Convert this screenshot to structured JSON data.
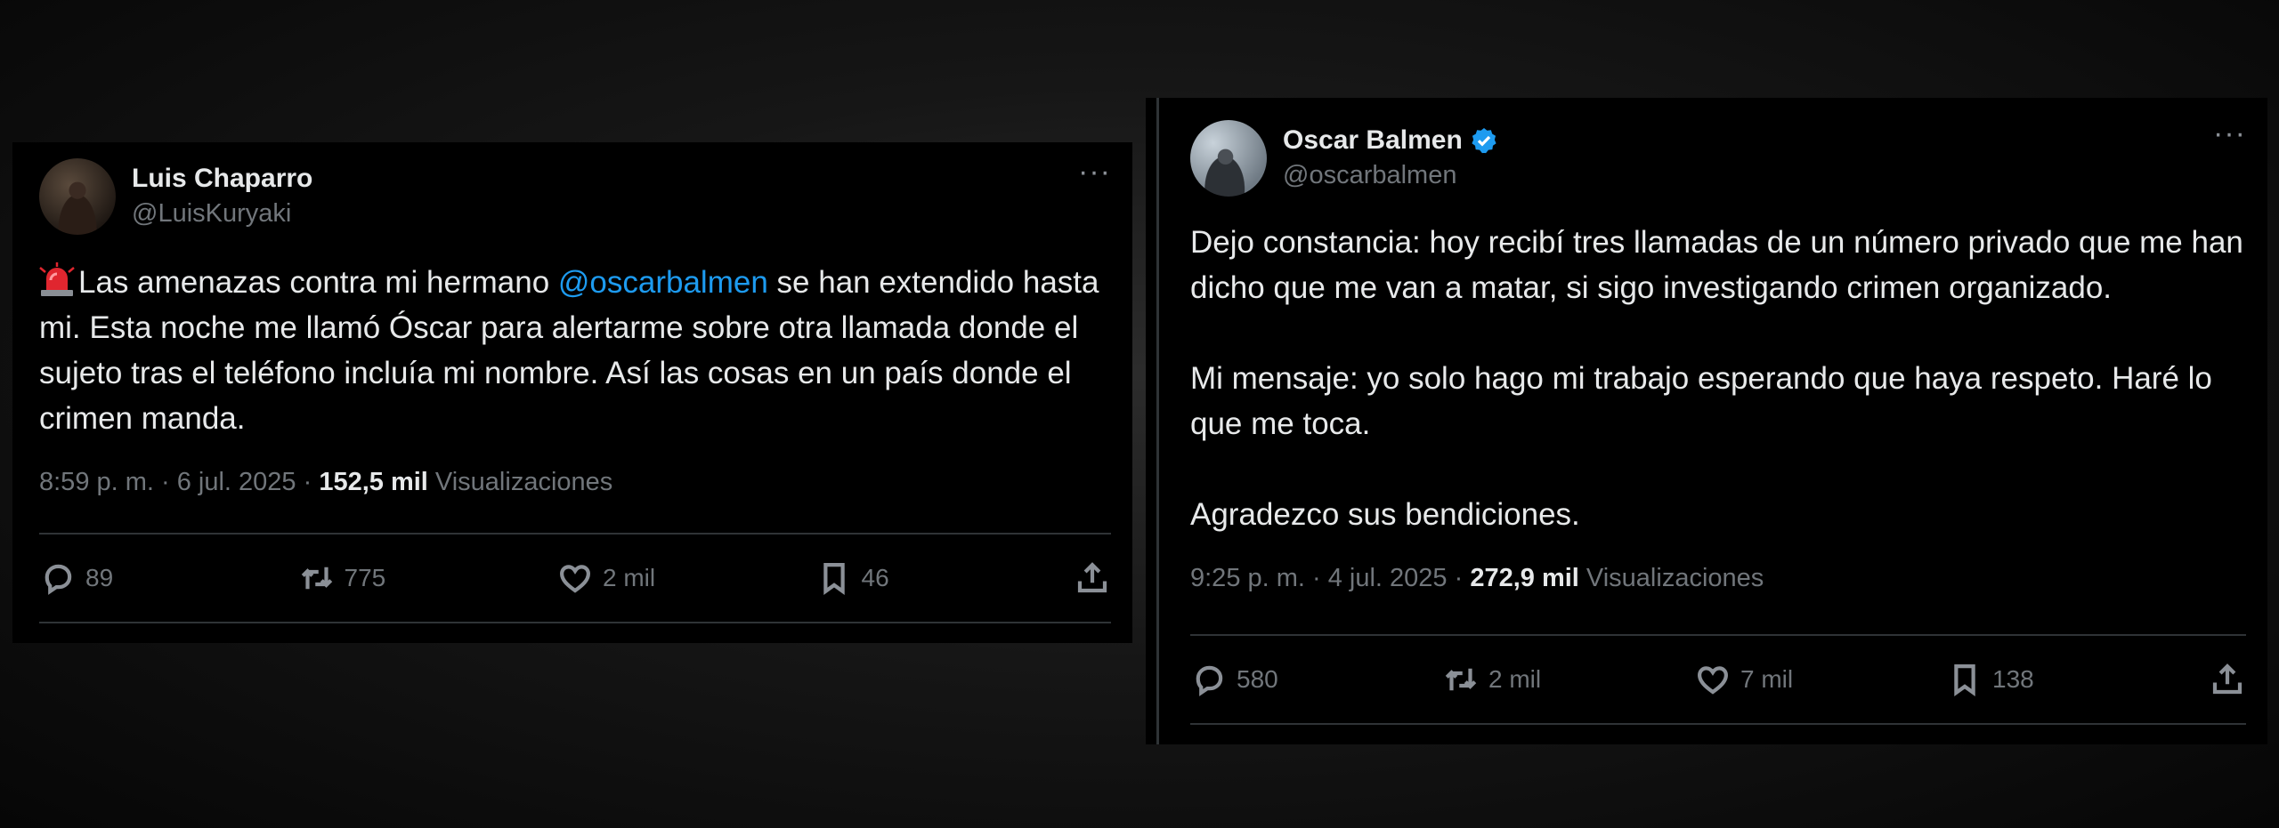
{
  "tweets": [
    {
      "author": {
        "name": "Luis Chaparro",
        "handle": "@LuisKuryaki",
        "verified": false
      },
      "more_icon": "more-horizontal-icon",
      "text_prefix_icon": "police-siren-emoji",
      "text_before_mention": "Las amenazas contra mi hermano ",
      "mention": "@oscarbalmen",
      "text_after_mention": " se han extendido hasta mi. Esta noche me llamó Óscar para alertarme sobre otra llamada donde el sujeto tras el teléfono incluía mi nombre. Así las cosas en un país donde el crimen manda.",
      "timestamp": "8:59 p. m. · 6 jul. 2025 · ",
      "views_count": "152,5 mil",
      "views_label": " Visualizaciones",
      "stats": {
        "replies": "89",
        "reposts": "775",
        "likes": "2 mil",
        "bookmarks": "46"
      }
    },
    {
      "author": {
        "name": "Oscar Balmen",
        "handle": "@oscarbalmen",
        "verified": true
      },
      "more_icon": "more-horizontal-icon",
      "text": "Dejo constancia: hoy recibí tres llamadas de un número privado que me han dicho que me van a matar, si sigo investigando crimen organizado.\n\nMi mensaje: yo solo hago mi trabajo esperando que haya respeto. Haré lo que me toca.\n\nAgradezco sus bendiciones.",
      "timestamp": "9:25 p. m. · 4 jul. 2025 · ",
      "views_count": "272,9 mil",
      "views_label": " Visualizaciones",
      "stats": {
        "replies": "580",
        "reposts": "2 mil",
        "likes": "7 mil",
        "bookmarks": "138"
      }
    }
  ],
  "colors": {
    "background": "#000000",
    "text": "#e7e9ea",
    "secondary": "#71767b",
    "accent": "#1d9bf0",
    "divider": "#2f3336"
  }
}
